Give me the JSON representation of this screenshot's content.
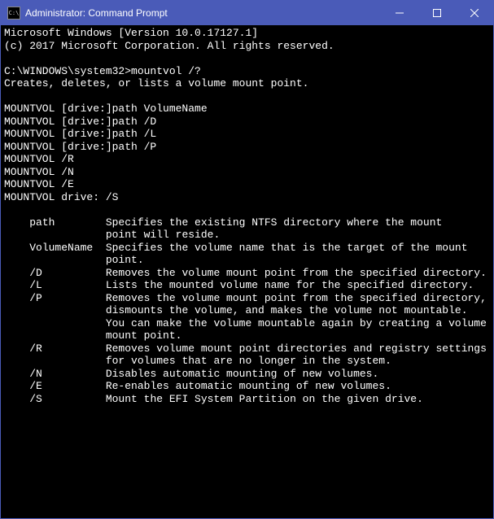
{
  "window": {
    "title": "Administrator: Command Prompt"
  },
  "terminal": {
    "line1": "Microsoft Windows [Version 10.0.17127.1]",
    "line2": "(c) 2017 Microsoft Corporation. All rights reserved.",
    "prompt_path": "C:\\WINDOWS\\system32>",
    "prompt_cmd": "mountvol /?",
    "desc": "Creates, deletes, or lists a volume mount point.",
    "usage1": "MOUNTVOL [drive:]path VolumeName",
    "usage2": "MOUNTVOL [drive:]path /D",
    "usage3": "MOUNTVOL [drive:]path /L",
    "usage4": "MOUNTVOL [drive:]path /P",
    "usage5": "MOUNTVOL /R",
    "usage6": "MOUNTVOL /N",
    "usage7": "MOUNTVOL /E",
    "usage8": "MOUNTVOL drive: /S",
    "opt_path": "    path        Specifies the existing NTFS directory where the mount",
    "opt_path2": "                point will reside.",
    "opt_volname": "    VolumeName  Specifies the volume name that is the target of the mount",
    "opt_volname2": "                point.",
    "opt_d": "    /D          Removes the volume mount point from the specified directory.",
    "opt_l": "    /L          Lists the mounted volume name for the specified directory.",
    "opt_p": "    /P          Removes the volume mount point from the specified directory,",
    "opt_p2": "                dismounts the volume, and makes the volume not mountable.",
    "opt_p3": "                You can make the volume mountable again by creating a volume",
    "opt_p4": "                mount point.",
    "opt_r": "    /R          Removes volume mount point directories and registry settings",
    "opt_r2": "                for volumes that are no longer in the system.",
    "opt_n": "    /N          Disables automatic mounting of new volumes.",
    "opt_e": "    /E          Re-enables automatic mounting of new volumes.",
    "opt_s": "    /S          Mount the EFI System Partition on the given drive."
  }
}
